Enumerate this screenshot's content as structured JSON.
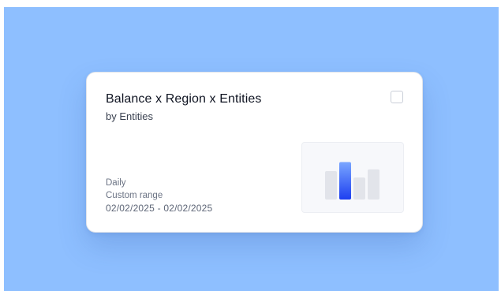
{
  "card": {
    "title": "Balance x Region x Entities",
    "subtitle": "by Entities",
    "frequency": "Daily",
    "range_label": "Custom range",
    "date_range": "02/02/2025  - 02/02/2025",
    "selected": false
  },
  "thumbnail": {
    "icon": "bar-chart-icon",
    "bars": [
      0.62,
      0.82,
      0.48,
      0.66
    ],
    "highlight_index": 1,
    "colors": {
      "bar": "#e2e4ea",
      "highlight_top": "#7aa6ff",
      "highlight_bottom": "#1d3ff0"
    }
  },
  "colors": {
    "background": "#8ebfff",
    "card": "#ffffff"
  }
}
